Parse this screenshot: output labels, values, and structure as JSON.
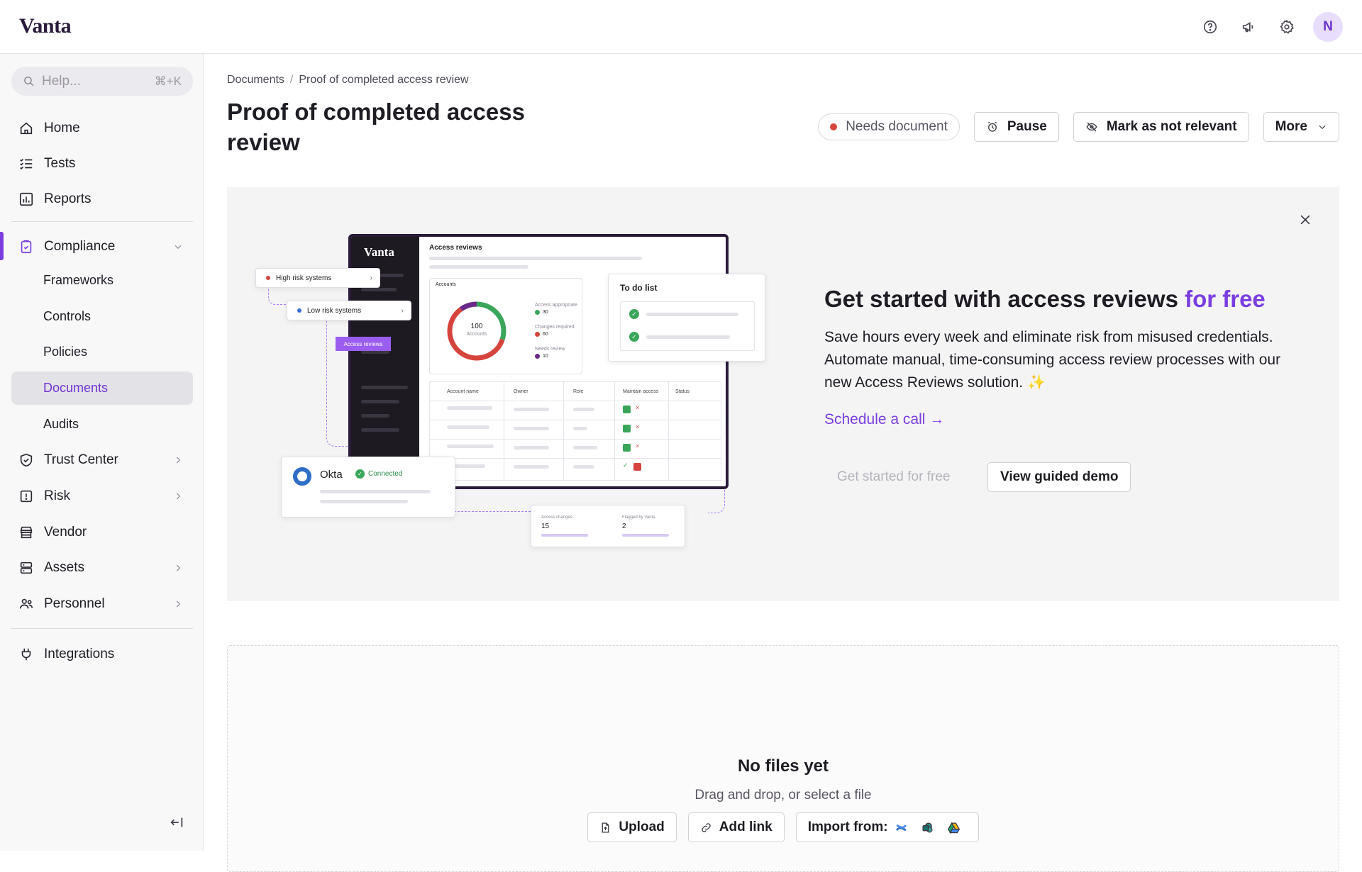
{
  "app": {
    "logo": "Vanta",
    "avatar_initial": "N"
  },
  "topbar": {
    "icons": [
      "help-circle-icon",
      "megaphone-icon",
      "gear-icon"
    ]
  },
  "search": {
    "placeholder": "Help...",
    "shortcut": "⌘+K"
  },
  "sidebar": {
    "items": [
      {
        "label": "Home",
        "icon": "home-icon"
      },
      {
        "label": "Tests",
        "icon": "list-check-icon"
      },
      {
        "label": "Reports",
        "icon": "bar-chart-icon"
      },
      {
        "label": "Compliance",
        "icon": "clipboard-check-icon",
        "expanded": true
      },
      {
        "label": "Frameworks"
      },
      {
        "label": "Controls"
      },
      {
        "label": "Policies"
      },
      {
        "label": "Documents",
        "active": true
      },
      {
        "label": "Audits"
      },
      {
        "label": "Trust Center",
        "icon": "shield-check-icon"
      },
      {
        "label": "Risk",
        "icon": "alert-square-icon"
      },
      {
        "label": "Vendor",
        "icon": "store-icon"
      },
      {
        "label": "Assets",
        "icon": "server-icon"
      },
      {
        "label": "Personnel",
        "icon": "users-icon"
      },
      {
        "label": "Integrations",
        "icon": "plug-icon"
      }
    ]
  },
  "breadcrumb": {
    "parent": "Documents",
    "separator": "/",
    "current": "Proof of completed access review"
  },
  "page": {
    "title": "Proof of completed access review"
  },
  "actions": {
    "status": "Needs document",
    "status_color": "#d6453d",
    "pause": "Pause",
    "not_relevant": "Mark as not relevant",
    "more": "More"
  },
  "promo": {
    "title_main": "Get started with access reviews ",
    "title_accent": "for free",
    "body": "Save hours every week and eliminate risk from misused credentials. Automate manual, time-consuming access review processes with our new Access Reviews solution. ✨",
    "link": "Schedule a call →",
    "get_started": "Get started for free",
    "demo": "View guided demo",
    "accent_color": "#7a3ee0"
  },
  "illustration": {
    "logo": "Vanta",
    "heading": "Access reviews",
    "accounts_label": "Accounts",
    "donut_value": "100",
    "donut_label": "Accounts",
    "legend": [
      {
        "label": "Access appropriate",
        "value": "30",
        "color": "#3aa65a"
      },
      {
        "label": "Changes required",
        "value": "60",
        "color": "#d6453d"
      },
      {
        "label": "Needs review",
        "value": "10",
        "color": "#6b2a8a"
      }
    ],
    "todo": "To do list",
    "high_risk": "High risk systems",
    "low_risk": "Low risk systems",
    "access_pill": "Access reviews",
    "columns": [
      "Account name",
      "Owner",
      "Role",
      "Maintain access",
      "Status"
    ],
    "okta": "Okta",
    "connected": "Connected",
    "access_changes_label": "Access changes",
    "access_changes_value": "15",
    "flagged_label": "Flagged by Vanta",
    "flagged_value": "2"
  },
  "upload": {
    "title": "No files yet",
    "subtitle": "Drag and drop, or select a file",
    "upload": "Upload",
    "add_link": "Add link",
    "import": "Import from:"
  }
}
